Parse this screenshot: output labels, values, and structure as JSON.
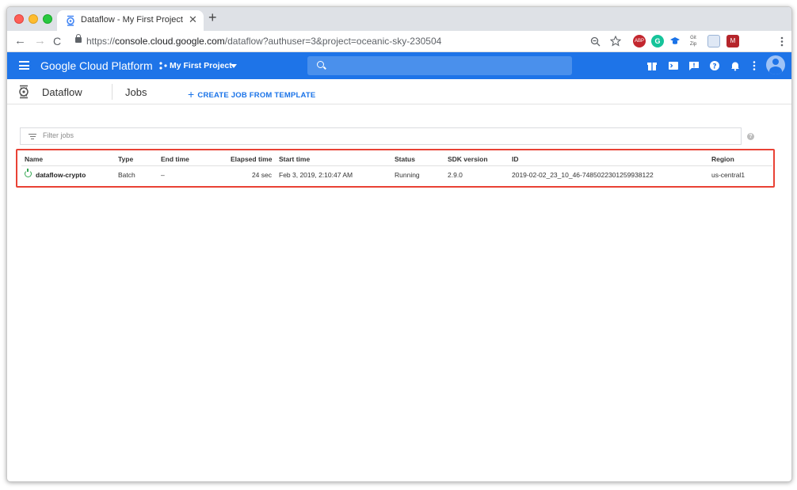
{
  "browser": {
    "tab_title": "Dataflow - My First Project - G",
    "tab_close": "✕",
    "new_tab": "+",
    "url_scheme": "https://",
    "url_domain": "console.cloud.google.com",
    "url_path": "/dataflow?authuser=3&project=oceanic-sky-230504",
    "nav_back": "←",
    "nav_forward": "→",
    "nav_reload": "C"
  },
  "gcp": {
    "brand": "Google Cloud Platform",
    "project": "My First Project",
    "accent": "#1e74e8"
  },
  "subheader": {
    "product": "Dataflow",
    "page": "Jobs",
    "create_label": "CREATE JOB FROM TEMPLATE",
    "create_plus": "+"
  },
  "filter": {
    "placeholder": "Filter jobs",
    "help": "?"
  },
  "table": {
    "headers": {
      "name": "Name",
      "type": "Type",
      "end_time": "End time",
      "elapsed": "Elapsed time",
      "start_time": "Start time",
      "status": "Status",
      "sdk": "SDK version",
      "id": "ID",
      "region": "Region"
    },
    "rows": [
      {
        "name": "dataflow-crypto",
        "type": "Batch",
        "end_time": "–",
        "elapsed": "24 sec",
        "start_time": "Feb 3, 2019, 2:10:47 AM",
        "status": "Running",
        "sdk": "2.9.0",
        "id": "2019-02-02_23_10_46-7485022301259938122",
        "region": "us-central1"
      }
    ]
  },
  "highlight_color": "#e94235"
}
